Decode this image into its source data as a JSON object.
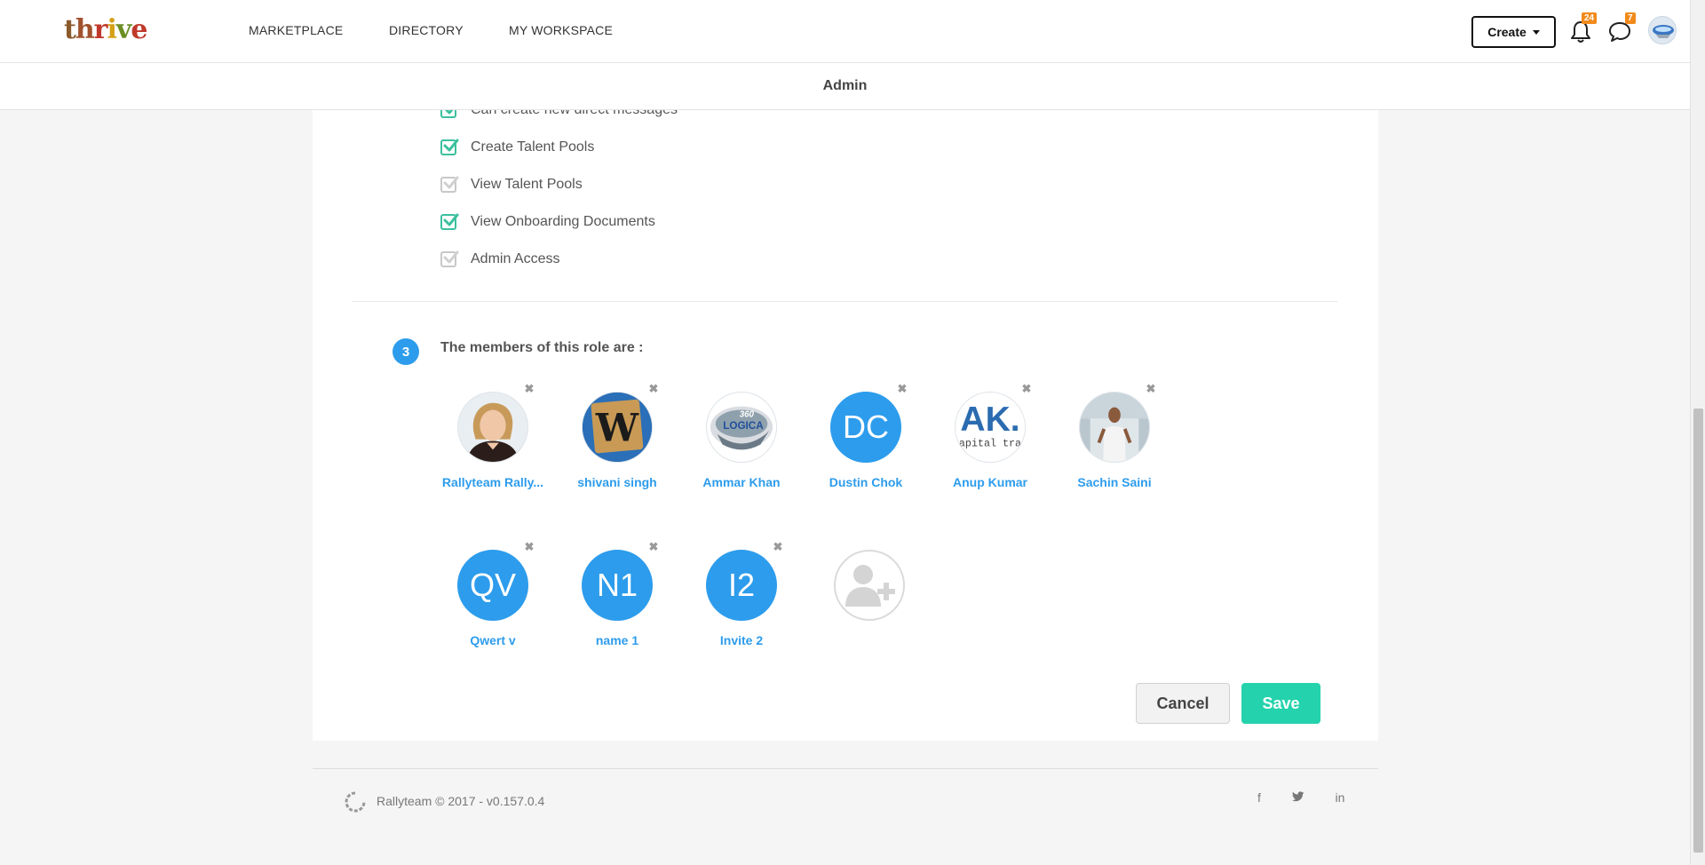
{
  "topbar": {
    "logo": [
      "t",
      "h",
      "r",
      "i",
      "v",
      "e"
    ],
    "logo_colors": [
      "#8b5a2b",
      "#a0522d",
      "#c0392b",
      "#d4a017",
      "#6b8e23",
      "#c0392b"
    ],
    "nav": [
      "MARKETPLACE",
      "DIRECTORY",
      "MY WORKSPACE"
    ],
    "create_label": "Create",
    "notifications_count": "24",
    "messages_count": "7"
  },
  "subheader": {
    "title": "Admin"
  },
  "permissions": [
    {
      "label": "Can create new direct messages",
      "checked": true
    },
    {
      "label": "Create Talent Pools",
      "checked": true
    },
    {
      "label": "View Talent Pools",
      "checked": false
    },
    {
      "label": "View Onboarding Documents",
      "checked": true
    },
    {
      "label": "Admin Access",
      "checked": false
    }
  ],
  "members_section": {
    "step": "3",
    "title": "The members of this role are :",
    "members": [
      {
        "name": "Rallyteam Rally...",
        "avatar": "photo-woman",
        "initials": ""
      },
      {
        "name": "shivani singh",
        "avatar": "wordpress-logo",
        "initials": ""
      },
      {
        "name": "Ammar Khan",
        "avatar": "360-logica-logo",
        "initials": ""
      },
      {
        "name": "Dustin Chok",
        "avatar": "initials",
        "initials": "DC"
      },
      {
        "name": "Anup Kumar",
        "avatar": "ak-logo",
        "initials": ""
      },
      {
        "name": "Sachin Saini",
        "avatar": "photo-man",
        "initials": ""
      },
      {
        "name": "Qwert v",
        "avatar": "initials",
        "initials": "QV"
      },
      {
        "name": "name 1",
        "avatar": "initials",
        "initials": "N1"
      },
      {
        "name": "Invite 2",
        "avatar": "initials",
        "initials": "I2"
      }
    ],
    "removable": [
      true,
      true,
      false,
      true,
      true,
      true,
      true,
      true,
      true
    ]
  },
  "logo_texts": {
    "wordpress": "W",
    "logica_360": "360",
    "logica": "LOGICA",
    "ak": "AK.",
    "ak_sub": "apital tra"
  },
  "actions": {
    "cancel_label": "Cancel",
    "save_label": "Save"
  },
  "footer": {
    "text": "Rallyteam © 2017 - v0.157.0.4",
    "social": [
      "f",
      "t",
      "in"
    ]
  },
  "colors": {
    "accent": "#2d9cec",
    "save": "#24d3ad",
    "check": "#3cc09e",
    "badge": "#f28a1b"
  }
}
